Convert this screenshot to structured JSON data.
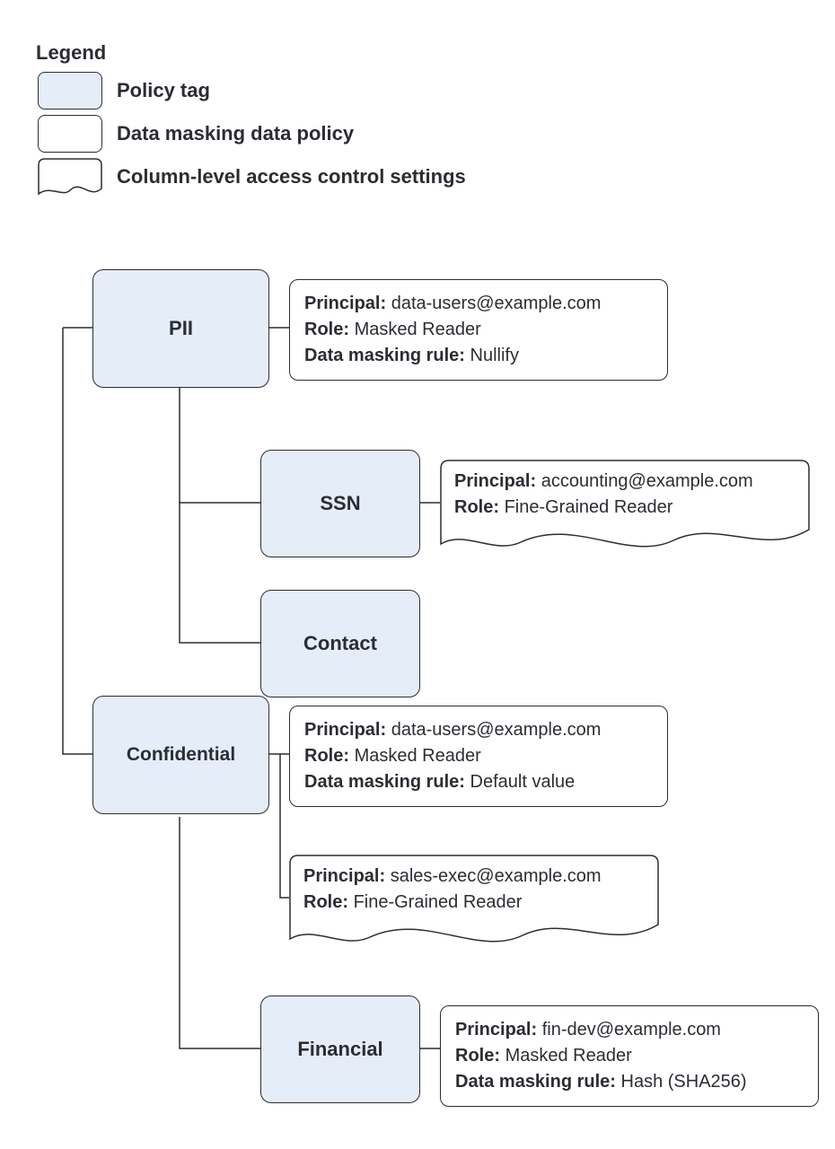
{
  "legend": {
    "title": "Legend",
    "items": [
      {
        "label": "Policy tag"
      },
      {
        "label": "Data masking data policy"
      },
      {
        "label": "Column-level access control settings"
      }
    ]
  },
  "labels": {
    "principal": "Principal:",
    "role": "Role:",
    "rule": "Data masking rule:"
  },
  "tags": {
    "pii": "PII",
    "ssn": "SSN",
    "contact": "Contact",
    "confidential": "Confidential",
    "financial": "Financial"
  },
  "cards": {
    "pii": {
      "principal": "data-users@example.com",
      "role": "Masked Reader",
      "rule": "Nullify"
    },
    "ssn": {
      "principal": "accounting@example.com",
      "role": "Fine-Grained Reader"
    },
    "conf1": {
      "principal": "data-users@example.com",
      "role": "Masked Reader",
      "rule": "Default value"
    },
    "conf2": {
      "principal": "sales-exec@example.com",
      "role": "Fine-Grained Reader"
    },
    "fin": {
      "principal": "fin-dev@example.com",
      "role": "Masked Reader",
      "rule": "Hash (SHA256)"
    }
  }
}
